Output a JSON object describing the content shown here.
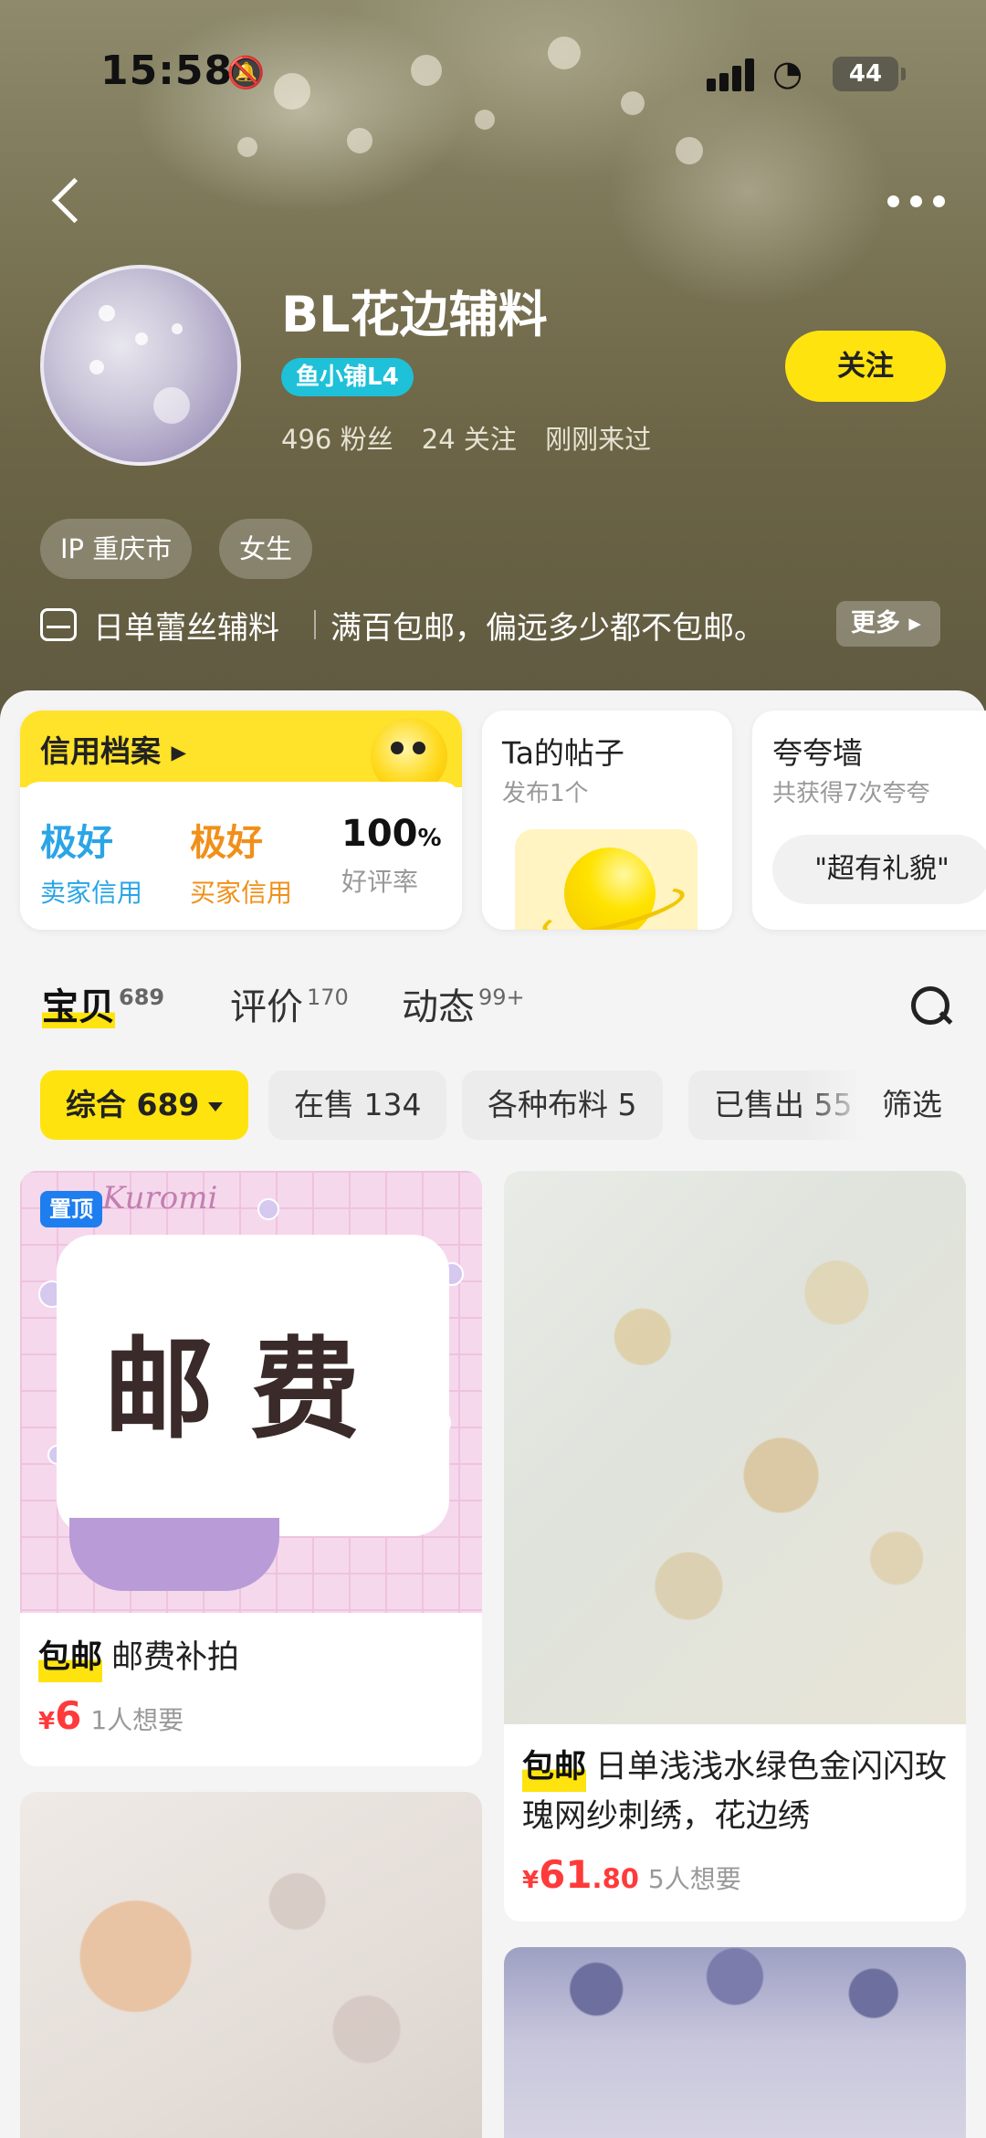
{
  "status_bar": {
    "time": "15:58",
    "battery": "44"
  },
  "header": {
    "shop_name": "BL花边辅料",
    "level_badge": "鱼小铺L4",
    "stats": [
      "496 粉丝",
      "24 关注",
      "刚刚来过"
    ],
    "follow_label": "关注",
    "tags": [
      "IP 重庆市",
      "女生"
    ],
    "intro_1": "日单蕾丝辅料",
    "intro_2": "满百包邮，偏远多少都不包邮。",
    "more_label": "更多"
  },
  "cards": {
    "credit": {
      "title": "信用档案",
      "seller_value": "极好",
      "seller_label": "卖家信用",
      "buyer_value": "极好",
      "buyer_label": "买家信用",
      "rate_value": "100",
      "rate_unit": "%",
      "rate_label": "好评率"
    },
    "posts": {
      "title": "Ta的帖子",
      "sub": "发布1个"
    },
    "praise": {
      "title": "夸夸墙",
      "sub": "共获得7次夸夸",
      "chip": "\"超有礼貌\""
    }
  },
  "tabs": [
    {
      "label": "宝贝",
      "count": "689"
    },
    {
      "label": "评价",
      "count": "170"
    },
    {
      "label": "动态",
      "count": "99+"
    }
  ],
  "filters": {
    "chips": [
      "综合 689",
      "在售 134",
      "各种布料 5",
      "已售出 55"
    ],
    "filter_label": "筛选"
  },
  "products": [
    {
      "pin": "置顶",
      "logo": "Kuromi",
      "image_text": "邮费",
      "badge": "包邮",
      "title": "邮费补拍",
      "price_symbol": "¥",
      "price_int": "6",
      "price_dec": "",
      "wants": "1人想要"
    },
    {
      "badge": "包邮",
      "title": "日单浅浅水绿色金闪闪玫瑰网纱刺绣，花边绣",
      "price_symbol": "¥",
      "price_int": "61",
      "price_dec": ".80",
      "wants": "5人想要"
    },
    {
      "title": ""
    },
    {
      "title": ""
    }
  ],
  "colors": {
    "accent": "#ffe30f",
    "price": "#ff3a3a",
    "seller_credit": "#2aa5e6",
    "buyer_credit": "#f0901a",
    "badge": "#1ec1d8",
    "pin": "#1e7ef0"
  }
}
